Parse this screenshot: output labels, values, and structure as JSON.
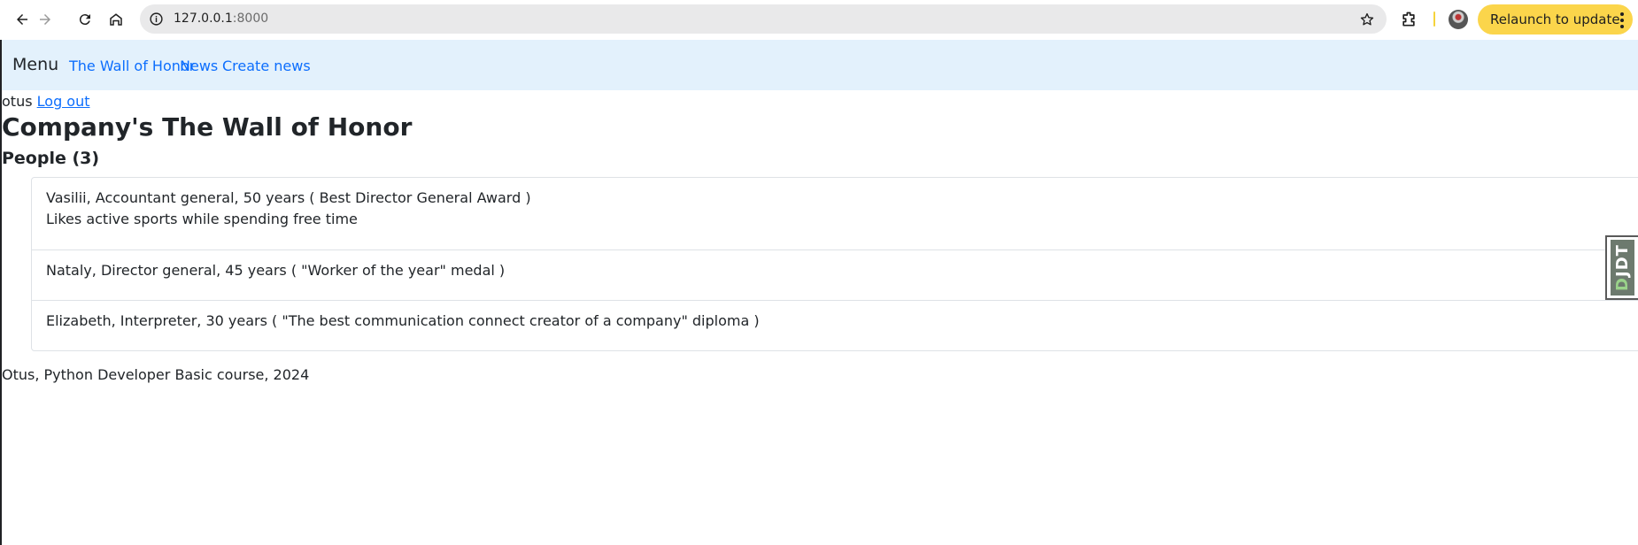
{
  "browser": {
    "url_host": "127.0.0.1",
    "url_port": ":8000",
    "relaunch_label": "Relaunch to update"
  },
  "navbar": {
    "brand": "Menu",
    "links": [
      "The Wall of Honor",
      "News",
      "Create news"
    ]
  },
  "user": {
    "username": "otus",
    "logout_label": "Log out"
  },
  "page": {
    "title": "Company's The Wall of Honor",
    "people_heading": "People (3)"
  },
  "people": [
    {
      "summary": "Vasilii, Accountant general, 50 years ( Best Director General Award )",
      "note": "Likes active sports while spending free time"
    },
    {
      "summary": "Nataly, Director general, 45 years ( \"Worker of the year\" medal )"
    },
    {
      "summary": "Elizabeth, Interpreter, 30 years ( \"The best communication connect creator of a company\" diploma )"
    }
  ],
  "footer": "Otus, Python Developer Basic course, 2024",
  "toolbar_handle": {
    "label_first": "D",
    "label_rest": "JDT"
  },
  "icons": [
    "back-arrow-icon",
    "forward-arrow-icon",
    "reload-icon",
    "home-icon",
    "site-info-icon",
    "bookmark-star-icon",
    "extensions-icon",
    "more-vert-icon"
  ],
  "colors": {
    "navbar_bg": "#e3f1fc",
    "link": "#0d6efd",
    "relaunch_bg": "#fbd54b",
    "omnibox_bg": "#e9e9ea"
  }
}
